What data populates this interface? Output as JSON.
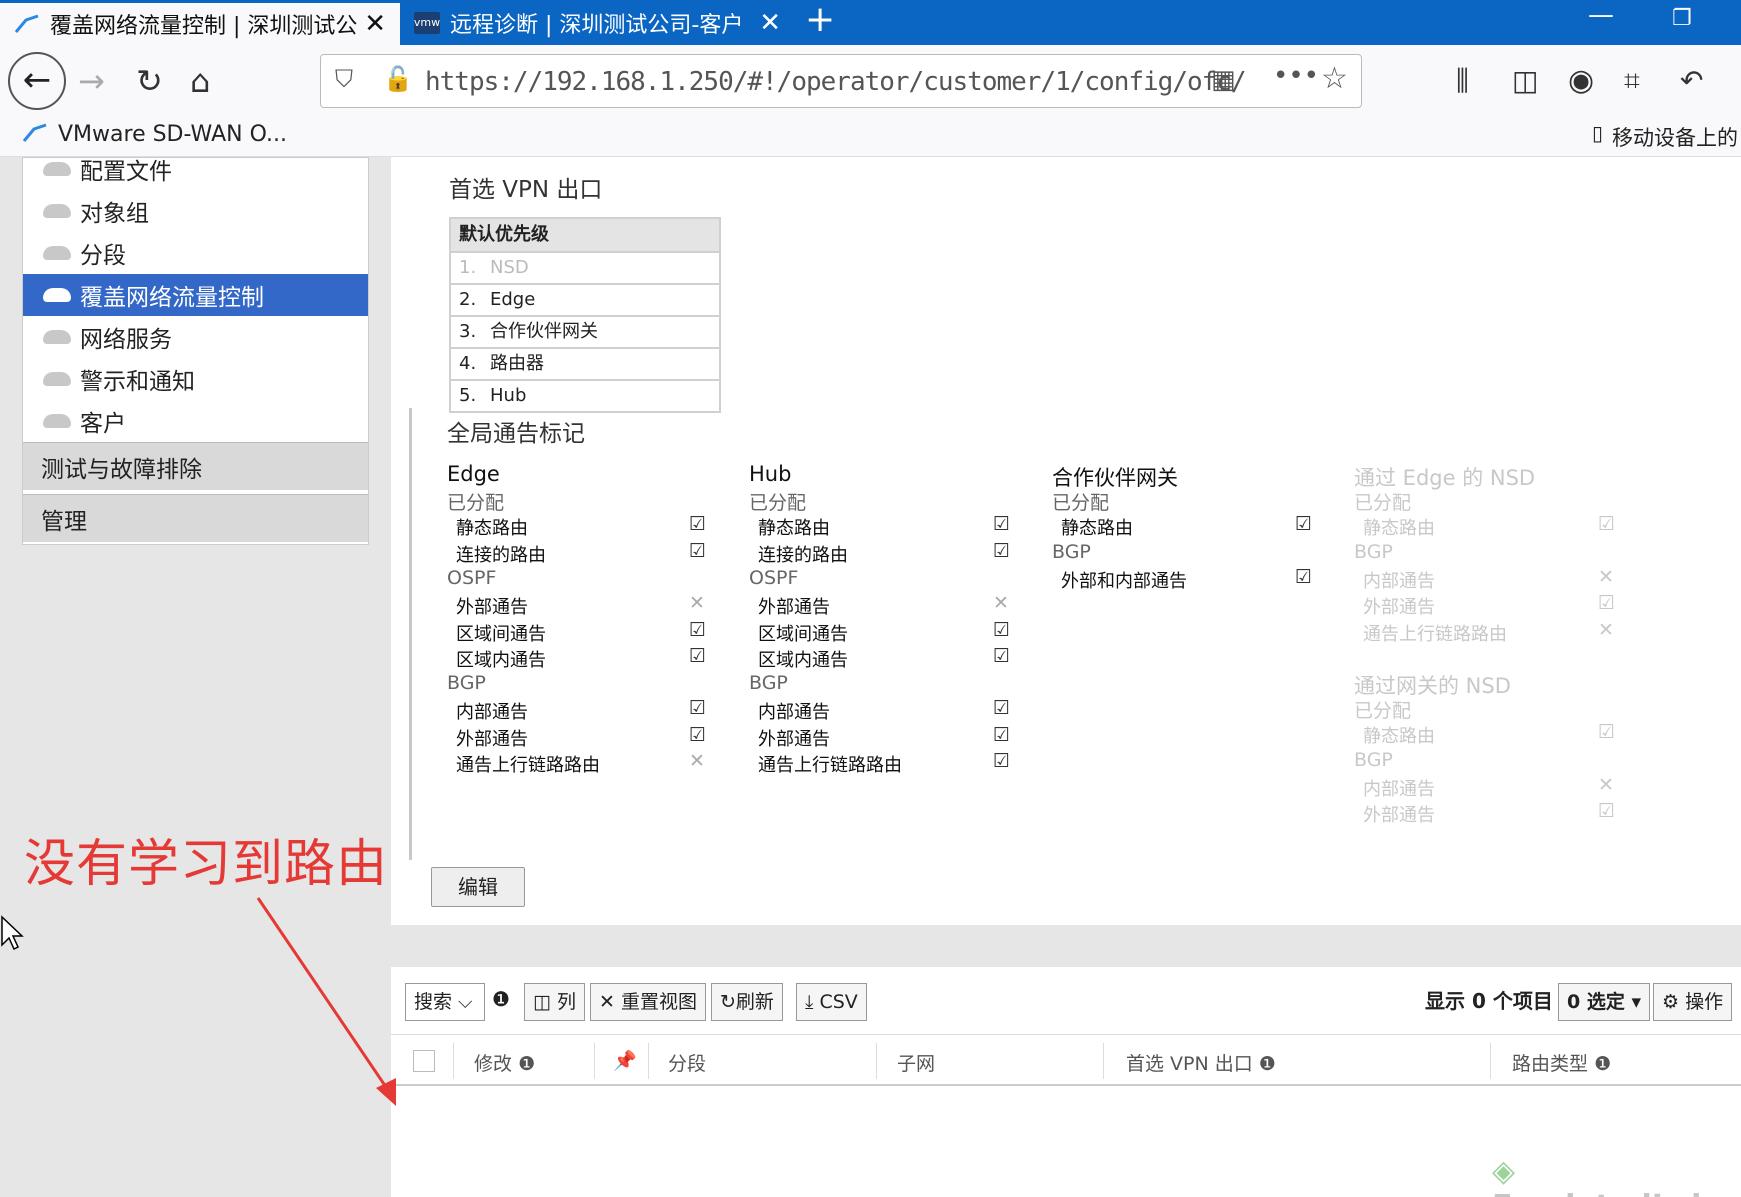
{
  "browser": {
    "tabs": [
      {
        "title": "覆盖网络流量控制 | 深圳测试公",
        "active": true
      },
      {
        "title": "远程诊断 | 深圳测试公司-客户",
        "active": false
      }
    ],
    "tab2_icon_text": "vmw",
    "new_tab_symbol": "+",
    "url": "https://192.168.1.250/#!/operator/customer/1/config/ofc/",
    "bookmark": "VMware SD-WAN O...",
    "mobile_bookmarks": "移动设备上的"
  },
  "sidebar": {
    "items": [
      {
        "label": "配置文件"
      },
      {
        "label": "对象组"
      },
      {
        "label": "分段"
      },
      {
        "label": "覆盖网络流量控制",
        "active": true
      },
      {
        "label": "网络服务"
      },
      {
        "label": "警示和通知"
      },
      {
        "label": "客户"
      }
    ],
    "groups": [
      "测试与故障排除",
      "管理"
    ]
  },
  "main": {
    "vpn_title": "首选 VPN 出口",
    "priority": {
      "header": "默认优先级",
      "rows": [
        {
          "num": "1.",
          "label": "NSD",
          "disabled": true
        },
        {
          "num": "2.",
          "label": "Edge"
        },
        {
          "num": "3.",
          "label": "合作伙伴网关"
        },
        {
          "num": "4.",
          "label": "路由器"
        },
        {
          "num": "5.",
          "label": "Hub"
        }
      ]
    },
    "global_title": "全局通告标记",
    "columns": [
      {
        "header": "Edge",
        "rows": [
          {
            "type": "sec",
            "label": "已分配"
          },
          {
            "type": "it",
            "label": "静态路由",
            "checked": true
          },
          {
            "type": "it",
            "label": "连接的路由",
            "checked": true
          },
          {
            "type": "sec",
            "label": "OSPF"
          },
          {
            "type": "it",
            "label": "外部通告",
            "checked": false
          },
          {
            "type": "it",
            "label": "区域间通告",
            "checked": true
          },
          {
            "type": "it",
            "label": "区域内通告",
            "checked": true
          },
          {
            "type": "sec",
            "label": "BGP"
          },
          {
            "type": "it",
            "label": "内部通告",
            "checked": true
          },
          {
            "type": "it",
            "label": "外部通告",
            "checked": true
          },
          {
            "type": "it",
            "label": "通告上行链路路由",
            "checked": false
          }
        ]
      },
      {
        "header": "Hub",
        "rows": [
          {
            "type": "sec",
            "label": "已分配"
          },
          {
            "type": "it",
            "label": "静态路由",
            "checked": true
          },
          {
            "type": "it",
            "label": "连接的路由",
            "checked": true
          },
          {
            "type": "sec",
            "label": "OSPF"
          },
          {
            "type": "it",
            "label": "外部通告",
            "checked": false
          },
          {
            "type": "it",
            "label": "区域间通告",
            "checked": true
          },
          {
            "type": "it",
            "label": "区域内通告",
            "checked": true
          },
          {
            "type": "sec",
            "label": "BGP"
          },
          {
            "type": "it",
            "label": "内部通告",
            "checked": true
          },
          {
            "type": "it",
            "label": "外部通告",
            "checked": true
          },
          {
            "type": "it",
            "label": "通告上行链路路由",
            "checked": true
          }
        ]
      },
      {
        "header": "合作伙伴网关",
        "rows": [
          {
            "type": "sec",
            "label": "已分配"
          },
          {
            "type": "it",
            "label": "静态路由",
            "checked": true
          },
          {
            "type": "sec",
            "label": "BGP"
          },
          {
            "type": "it",
            "label": "外部和内部通告",
            "checked": true
          }
        ]
      },
      {
        "header": "通过 Edge 的 NSD",
        "faded": true,
        "rows": [
          {
            "type": "sec",
            "label": "已分配"
          },
          {
            "type": "it",
            "label": "静态路由",
            "checked": true
          },
          {
            "type": "sec",
            "label": "BGP"
          },
          {
            "type": "it",
            "label": "内部通告",
            "checked": false
          },
          {
            "type": "it",
            "label": "外部通告",
            "checked": true
          },
          {
            "type": "it",
            "label": "通告上行链路路由",
            "checked": false
          },
          {
            "type": "gap"
          },
          {
            "type": "hd",
            "label": "通过网关的 NSD"
          },
          {
            "type": "sec",
            "label": "已分配"
          },
          {
            "type": "it",
            "label": "静态路由",
            "checked": true
          },
          {
            "type": "sec",
            "label": "BGP"
          },
          {
            "type": "it",
            "label": "内部通告",
            "checked": false
          },
          {
            "type": "it",
            "label": "外部通告",
            "checked": true
          }
        ]
      }
    ],
    "edit_button": "编辑"
  },
  "grid": {
    "search": "搜索",
    "columns_btn": "列",
    "reset_btn": "重置视图",
    "refresh_btn": "刷新",
    "csv_btn": "CSV",
    "count_text": "显示 0 个项目",
    "selected": "0 选定",
    "actions": "操作",
    "headers": [
      "修改",
      "分段",
      "子网",
      "首选 VPN 出口",
      "路由类型"
    ]
  },
  "annotation": "没有学习到路由",
  "watermark": "EmulatedLab"
}
